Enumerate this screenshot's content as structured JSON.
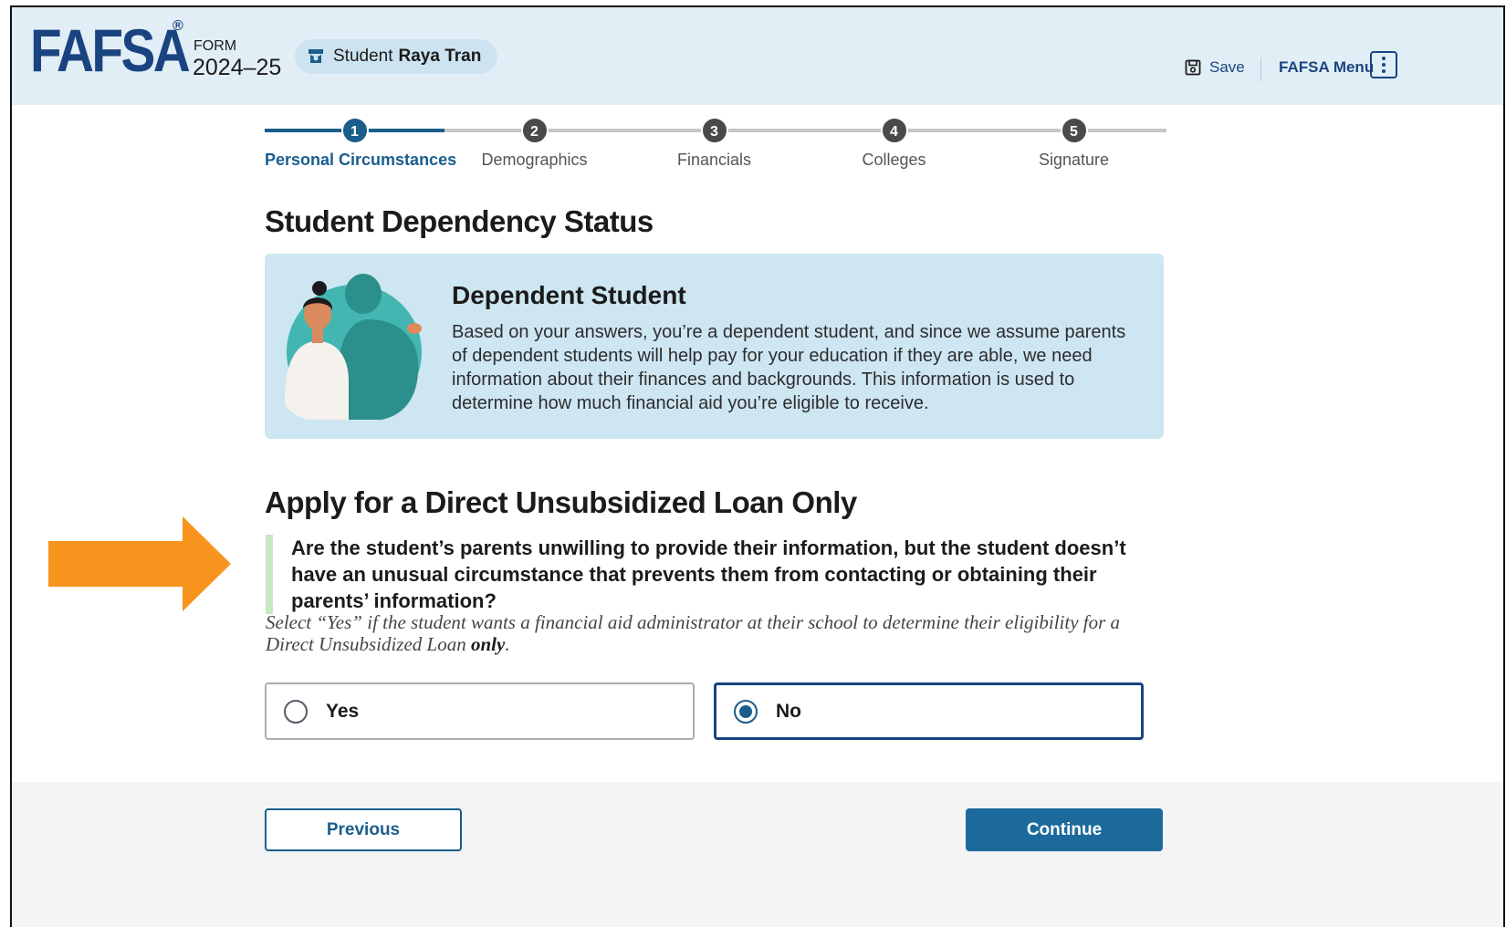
{
  "header": {
    "logo_text": "FAFSA",
    "logo_registered": "®",
    "form_label": "FORM",
    "form_year": "2024–25",
    "student_role": "Student",
    "student_name": "Raya Tran",
    "save_label": "Save",
    "menu_label": "FAFSA Menu"
  },
  "stepper": {
    "steps": [
      {
        "number": "1",
        "label": "Personal Circumstances",
        "active": true
      },
      {
        "number": "2",
        "label": "Demographics",
        "active": false
      },
      {
        "number": "3",
        "label": "Financials",
        "active": false
      },
      {
        "number": "4",
        "label": "Colleges",
        "active": false
      },
      {
        "number": "5",
        "label": "Signature",
        "active": false
      }
    ]
  },
  "page_title": "Student Dependency Status",
  "info_card": {
    "heading": "Dependent Student",
    "body": "Based on your answers, you’re a dependent student, and since we assume parents of dependent students will help pay for your education if they are able, we need information about their finances and backgrounds. This information is used to determine how much financial aid you’re eligible to receive."
  },
  "section_title": "Apply for a Direct Unsubsidized Loan Only",
  "question": "Are the student’s parents unwilling to provide their information, but the student doesn’t have an unusual circumstance that prevents them from contacting or obtaining their parents’ information?",
  "hint": {
    "text": "Select “Yes” if the student wants a financial aid administrator at their school to determine their eligibility for a Direct Unsubsidized Loan ",
    "emphasis": "only",
    "end": "."
  },
  "options": [
    {
      "label": "Yes",
      "selected": false
    },
    {
      "label": "No",
      "selected": true
    }
  ],
  "footer": {
    "previous_label": "Previous",
    "continue_label": "Continue"
  },
  "colors": {
    "brand_navy": "#1a4480",
    "primary_blue": "#1c6a9c",
    "header_bg": "#e1eef6",
    "card_bg": "#cde6f2",
    "annotation_arrow": "#f7941d",
    "question_accent": "#c7e9c0"
  },
  "icons": {
    "student": "graduation-cap-icon",
    "save": "floppy-disk-icon",
    "menu": "kebab-menu-icon",
    "annotation": "arrow-right-icon"
  }
}
